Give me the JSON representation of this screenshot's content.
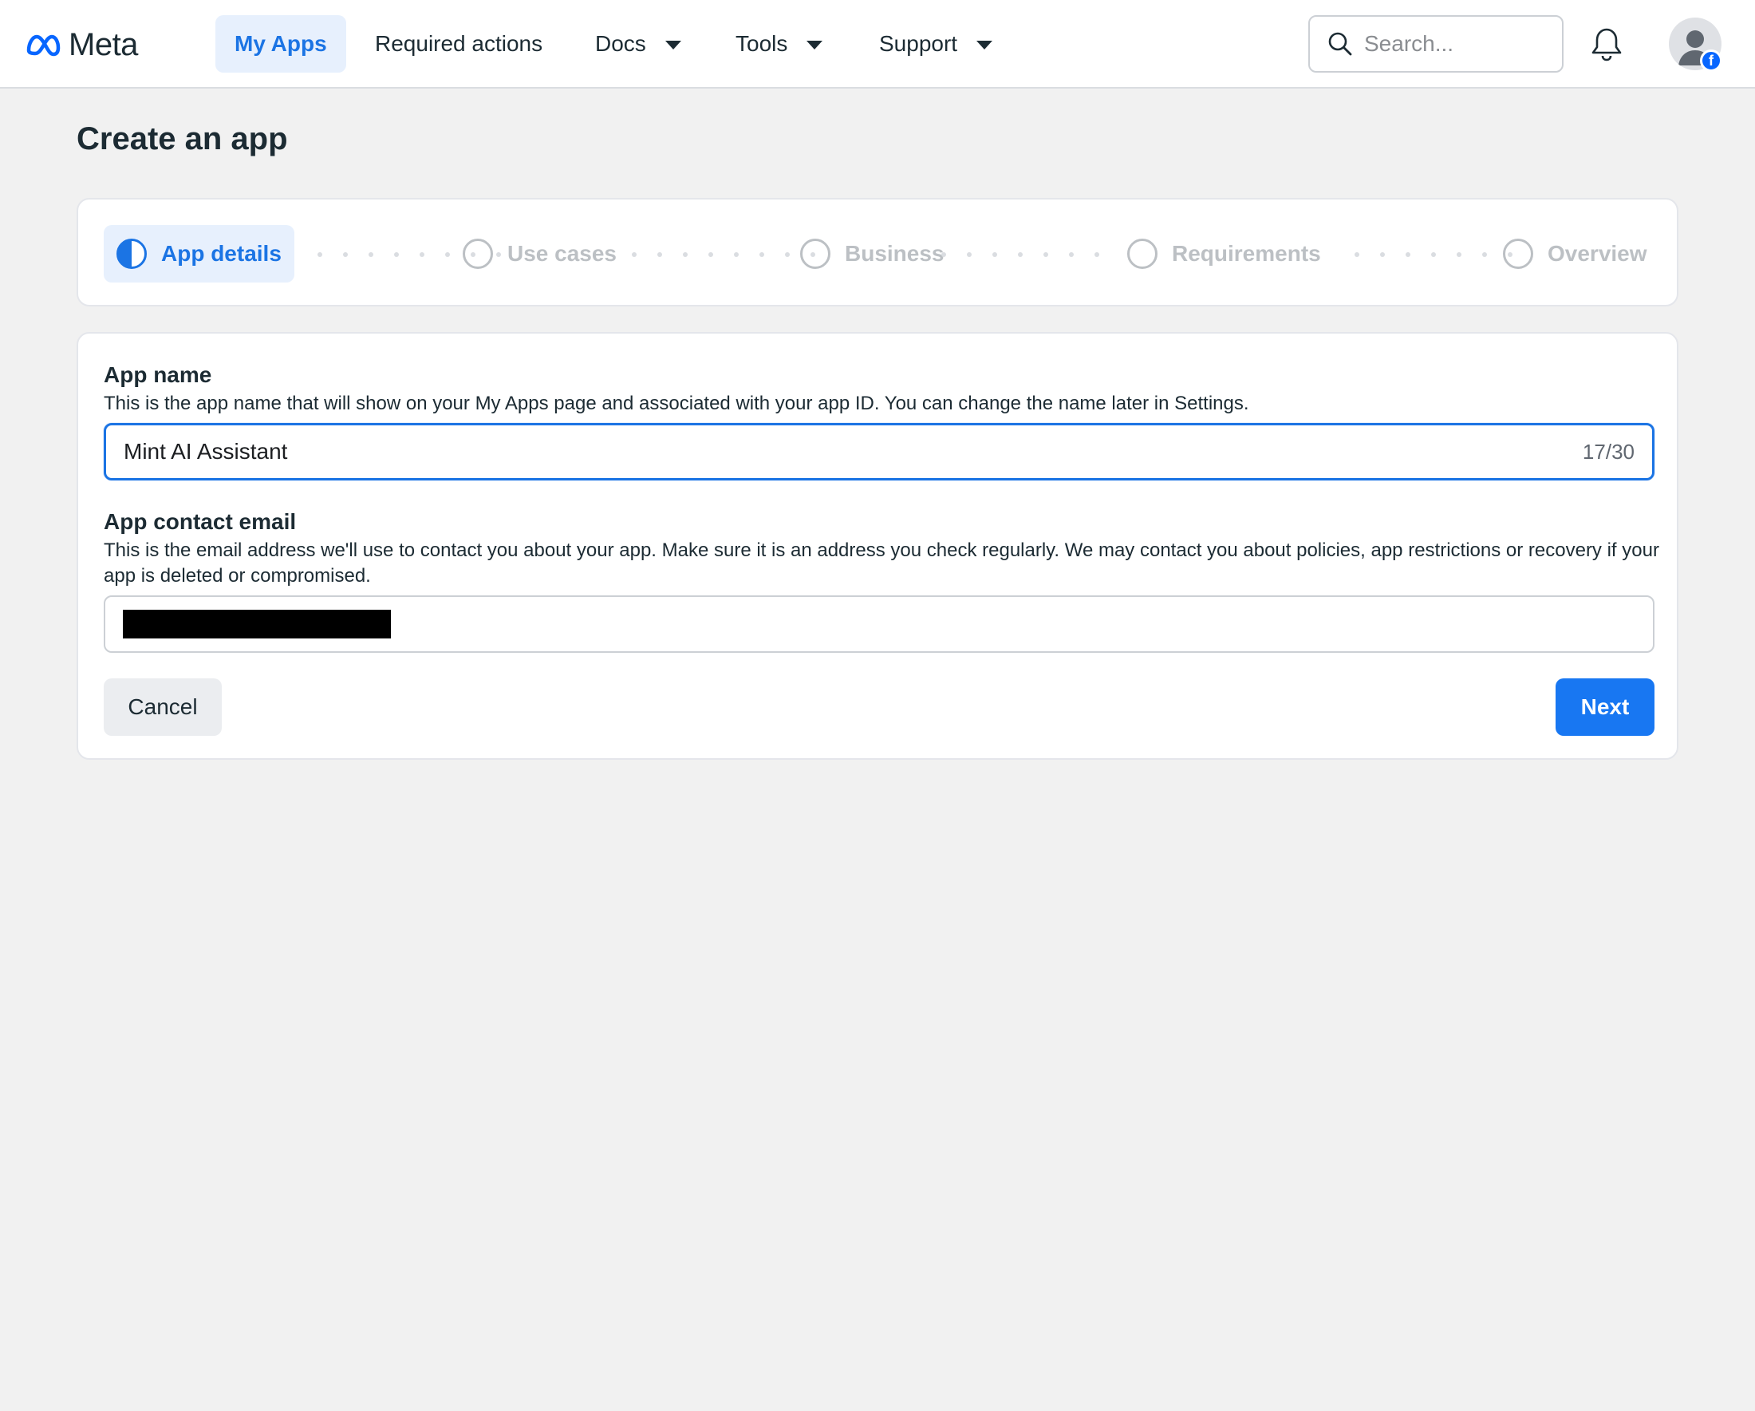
{
  "header": {
    "logo_text": "Meta",
    "nav": [
      {
        "label": "My Apps",
        "active": true
      },
      {
        "label": "Required actions"
      },
      {
        "label": "Docs",
        "has_dropdown": true
      },
      {
        "label": "Tools",
        "has_dropdown": true
      },
      {
        "label": "Support",
        "has_dropdown": true
      }
    ],
    "search_placeholder": "Search...",
    "avatar_badge": "f"
  },
  "page": {
    "title": "Create an app"
  },
  "stepper": {
    "steps": [
      {
        "label": "App details",
        "state": "in-progress"
      },
      {
        "label": "Use cases",
        "state": "pending"
      },
      {
        "label": "Business",
        "state": "pending"
      },
      {
        "label": "Requirements",
        "state": "pending"
      },
      {
        "label": "Overview",
        "state": "pending"
      }
    ]
  },
  "form": {
    "app_name": {
      "label": "App name",
      "help": "This is the app name that will show on your My Apps page and associated with your app ID. You can change the name later in Settings.",
      "value": "Mint AI Assistant",
      "counter": "17/30"
    },
    "contact_email": {
      "label": "App contact email",
      "help": "This is the email address we'll use to contact you about your app. Make sure it is an address you check regularly. We may contact you about policies, app restrictions or recovery if your app is deleted or compromised.",
      "value": ""
    },
    "cancel_label": "Cancel",
    "next_label": "Next"
  },
  "colors": {
    "accent": "#1b74e4",
    "primary_button": "#1877f2",
    "page_background": "#f1f1f1"
  }
}
